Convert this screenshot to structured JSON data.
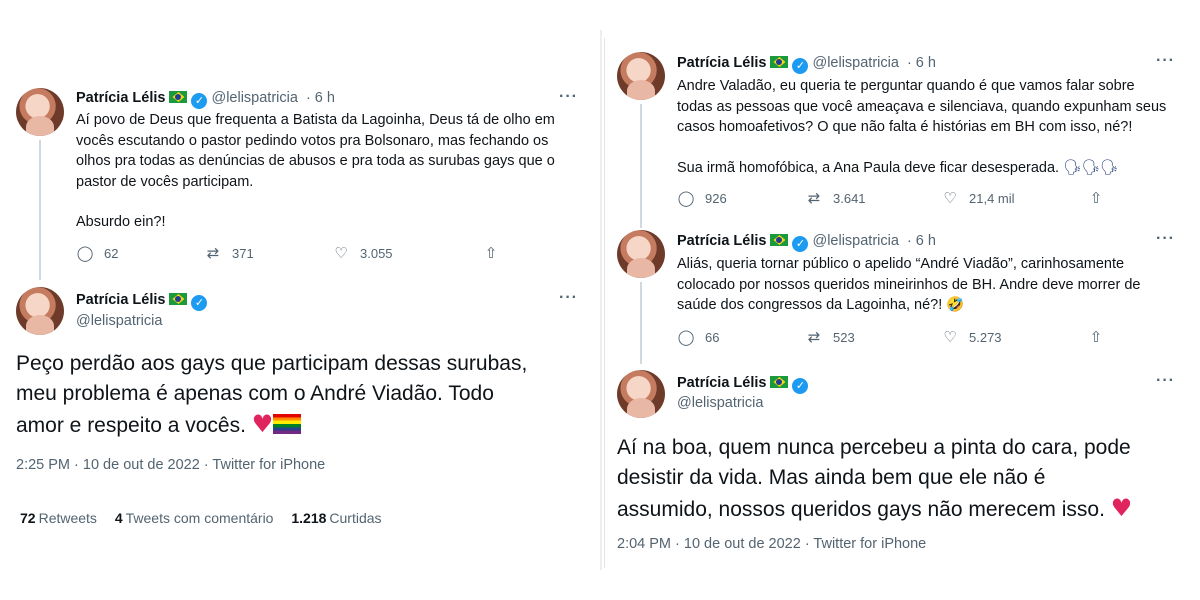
{
  "left": {
    "tweet1": {
      "name": "Patrícia Lélis",
      "handle": "@lelispatricia",
      "time": "· 6 h",
      "lines": [
        "Aí povo de Deus que frequenta a Batista da Lagoinha, Deus tá de olho em",
        "vocês escutando o pastor pedindo votos pra Bolsonaro, mas fechando os",
        "olhos pra todas as denúncias de abusos e pra toda as surubas gays que o",
        "pastor de vocês participam."
      ],
      "line2": "Absurdo ein?!",
      "replies": "62",
      "retweets": "371",
      "likes": "3.055"
    },
    "tweet2": {
      "name": "Patrícia Lélis",
      "handle": "@lelispatricia",
      "lines": [
        "Peço perdão aos gays que participam dessas surubas,",
        "meu problema é apenas com o André Viadão. Todo",
        "amor e respeito a vocês."
      ],
      "meta": "2:25 PM · 10 de out de 2022 · Twitter for iPhone",
      "retweets_count": "72",
      "retweets_label": "Retweets",
      "quotes_count": "4",
      "quotes_label": "Tweets com comentário",
      "likes_count": "1.218",
      "likes_label": "Curtidas"
    }
  },
  "right": {
    "tweet1": {
      "name": "Patrícia Lélis",
      "handle": "@lelispatricia",
      "time": "· 6 h",
      "lines": [
        "Andre Valadão, eu queria te perguntar quando é que vamos falar sobre",
        "todas as pessoas que você ameaçava e silenciava, quando expunham seus",
        "casos homoafetivos? O que não falta é histórias em BH com isso, né?!"
      ],
      "line2": "Sua irmã homofóbica, a Ana Paula deve ficar desesperada.",
      "emoji": "🗣🗣🗣",
      "replies": "926",
      "retweets": "3.641",
      "likes": "21,4 mil"
    },
    "tweet2": {
      "name": "Patrícia Lélis",
      "handle": "@lelispatricia",
      "time": "· 6 h",
      "lines": [
        "Aliás, queria tornar público o apelido “André Viadão”, carinhosamente",
        "colocado por nossos queridos mineirinhos de BH. Andre deve morrer de",
        "saúde dos congressos da Lagoinha, né?!"
      ],
      "emoji": "🤣",
      "replies": "66",
      "retweets": "523",
      "likes": "5.273"
    },
    "tweet3": {
      "name": "Patrícia Lélis",
      "handle": "@lelispatricia",
      "lines": [
        "Aí na boa, quem nunca percebeu a pinta do cara, pode",
        "desistir da vida. Mas ainda bem que ele não é",
        "assumido, nossos queridos gays não merecem isso."
      ],
      "meta": "2:04 PM · 10 de out de 2022 · Twitter for iPhone"
    }
  },
  "icons": {
    "reply": "reply-icon",
    "retweet": "retweet-icon",
    "like": "heart-icon",
    "share": "share-icon",
    "more": "more-icon",
    "verified": "verified-badge-icon",
    "flag": "brazil-flag-icon",
    "heart_emoji": "red-heart-emoji",
    "rainbow": "rainbow-flag-emoji"
  },
  "colors": {
    "verified": "#1d9bf0",
    "muted": "#536471",
    "text": "#0f1419",
    "heart": "#e0245e"
  }
}
